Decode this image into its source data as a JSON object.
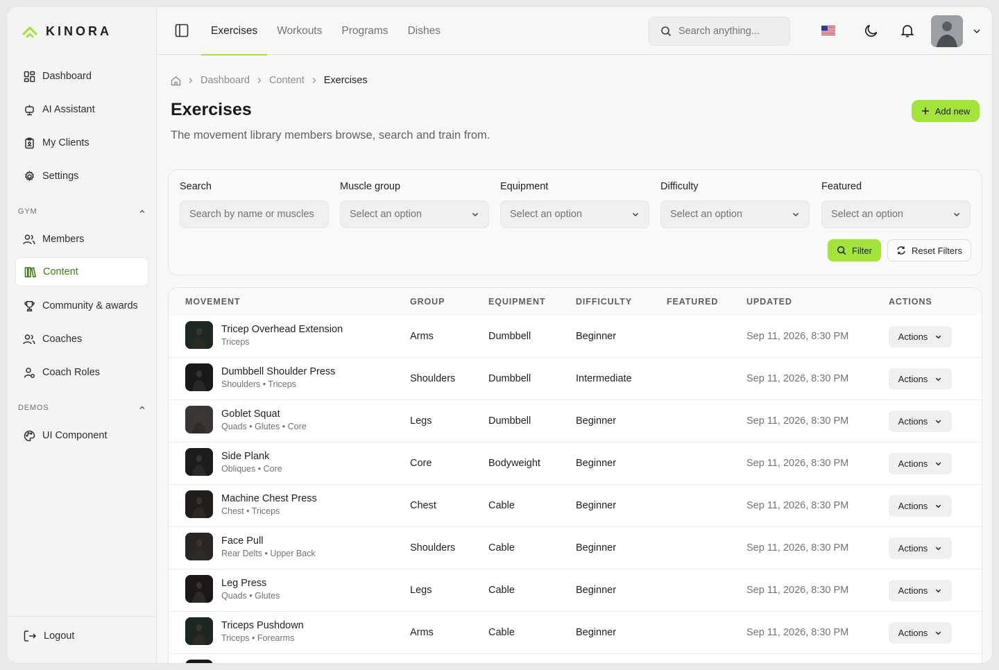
{
  "app": {
    "name": "KINORA"
  },
  "sidebar": {
    "items": [
      {
        "label": "Dashboard",
        "icon": "dashboard-icon"
      },
      {
        "label": "AI Assistant",
        "icon": "robot-icon"
      },
      {
        "label": "My Clients",
        "icon": "clipboard-icon"
      },
      {
        "label": "Settings",
        "icon": "gear-icon"
      }
    ],
    "gym_label": "GYM",
    "gym_items": [
      {
        "label": "Members",
        "icon": "users-icon"
      },
      {
        "label": "Content",
        "icon": "library-icon",
        "active": true
      },
      {
        "label": "Community & awards",
        "icon": "trophy-icon"
      },
      {
        "label": "Coaches",
        "icon": "users-icon"
      },
      {
        "label": "Coach Roles",
        "icon": "user-role-icon"
      }
    ],
    "demos_label": "DEMOS",
    "demo_items": [
      {
        "label": "UI Component",
        "icon": "palette-icon"
      }
    ],
    "logout": "Logout"
  },
  "topbar": {
    "tabs": [
      "Exercises",
      "Workouts",
      "Programs",
      "Dishes"
    ],
    "active_tab": "Exercises",
    "search_placeholder": "Search anything..."
  },
  "breadcrumb": [
    "Dashboard",
    "Content",
    "Exercises"
  ],
  "page": {
    "title": "Exercises",
    "subtitle": "The movement library members browse, search and train from.",
    "add_label": "Add new"
  },
  "filters": {
    "search": {
      "label": "Search",
      "placeholder": "Search by name or muscles"
    },
    "muscle_group": {
      "label": "Muscle group",
      "value": "Select an option"
    },
    "equipment": {
      "label": "Equipment",
      "value": "Select an option"
    },
    "difficulty": {
      "label": "Difficulty",
      "value": "Select an option"
    },
    "featured": {
      "label": "Featured",
      "value": "Select an option"
    },
    "filter_label": "Filter",
    "reset_label": "Reset Filters"
  },
  "table": {
    "headers": [
      "MOVEMENT",
      "GROUP",
      "EQUIPMENT",
      "DIFFICULTY",
      "FEATURED",
      "UPDATED",
      "ACTIONS"
    ],
    "action_label": "Actions",
    "rows": [
      {
        "name": "Tricep Overhead Extension",
        "muscles": "Triceps",
        "group": "Arms",
        "equipment": "Dumbbell",
        "difficulty": "Beginner",
        "featured": "",
        "updated": "Sep 11, 2026, 8:30 PM"
      },
      {
        "name": "Dumbbell Shoulder Press",
        "muscles": "Shoulders • Triceps",
        "group": "Shoulders",
        "equipment": "Dumbbell",
        "difficulty": "Intermediate",
        "featured": "",
        "updated": "Sep 11, 2026, 8:30 PM"
      },
      {
        "name": "Goblet Squat",
        "muscles": "Quads • Glutes • Core",
        "group": "Legs",
        "equipment": "Dumbbell",
        "difficulty": "Beginner",
        "featured": "",
        "updated": "Sep 11, 2026, 8:30 PM"
      },
      {
        "name": "Side Plank",
        "muscles": "Obliques • Core",
        "group": "Core",
        "equipment": "Bodyweight",
        "difficulty": "Beginner",
        "featured": "",
        "updated": "Sep 11, 2026, 8:30 PM"
      },
      {
        "name": "Machine Chest Press",
        "muscles": "Chest • Triceps",
        "group": "Chest",
        "equipment": "Cable",
        "difficulty": "Beginner",
        "featured": "",
        "updated": "Sep 11, 2026, 8:30 PM"
      },
      {
        "name": "Face Pull",
        "muscles": "Rear Delts • Upper Back",
        "group": "Shoulders",
        "equipment": "Cable",
        "difficulty": "Beginner",
        "featured": "",
        "updated": "Sep 11, 2026, 8:30 PM"
      },
      {
        "name": "Leg Press",
        "muscles": "Quads • Glutes",
        "group": "Legs",
        "equipment": "Cable",
        "difficulty": "Beginner",
        "featured": "",
        "updated": "Sep 11, 2026, 8:30 PM"
      },
      {
        "name": "Triceps Pushdown",
        "muscles": "Triceps • Forearms",
        "group": "Arms",
        "equipment": "Cable",
        "difficulty": "Beginner",
        "featured": "",
        "updated": "Sep 11, 2026, 8:30 PM"
      }
    ]
  },
  "colors": {
    "accent": "#a4e23c",
    "accent_text": "#3d7a12",
    "background": "#f7f7f6"
  }
}
